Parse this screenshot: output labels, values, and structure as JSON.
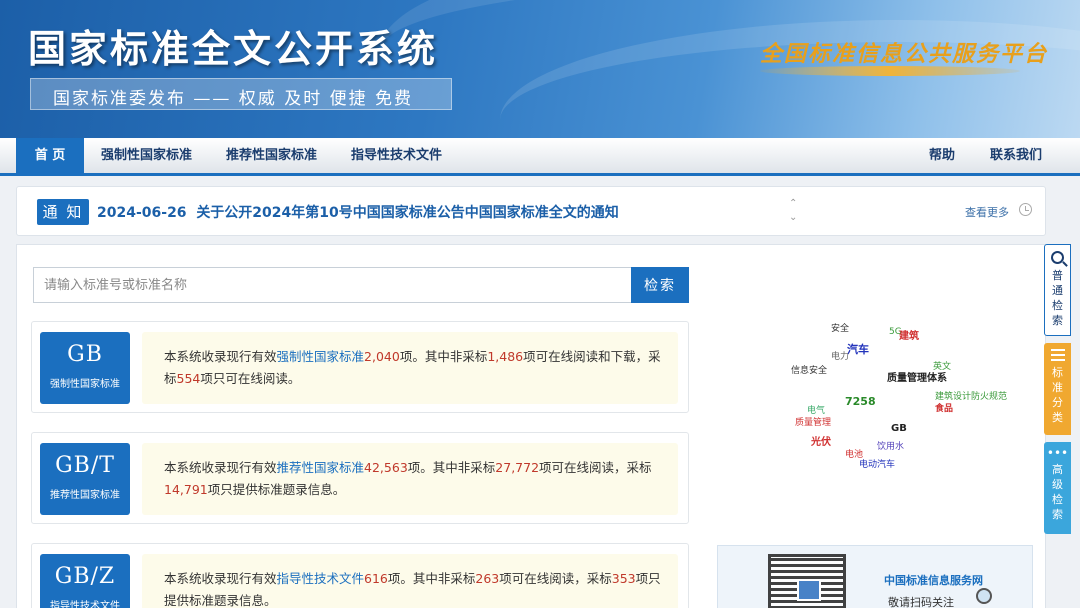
{
  "header": {
    "site_title": "国家标准全文公开系统",
    "slogan": "国家标准委发布 —— 权威 及时 便捷 免费",
    "platform": "全国标准信息公共服务平台"
  },
  "nav": {
    "items": [
      "首 页",
      "强制性国家标准",
      "推荐性国家标准",
      "指导性技术文件"
    ],
    "help": "帮助",
    "contact": "联系我们"
  },
  "notice": {
    "badge": "通 知",
    "date": "2024-06-26",
    "title": "关于公开2024年第10号中国国家标准公告中国国家标准全文的通知",
    "more": "查看更多"
  },
  "search": {
    "placeholder": "请输入标准号或标准名称",
    "button": "检索"
  },
  "cards": [
    {
      "code": "GB",
      "type": "强制性国家标准",
      "p1": "本系统收录现行有效",
      "link": "强制性国家标准",
      "count": "2,040",
      "p2": "项。其中非采标",
      "n1": "1,486",
      "p3": "项可在线阅读和下载，采标",
      "n2": "554",
      "p4": "项只可在线阅读。"
    },
    {
      "code": "GB/T",
      "type": "推荐性国家标准",
      "p1": "本系统收录现行有效",
      "link": "推荐性国家标准",
      "count": "42,563",
      "p2": "项。其中非采标",
      "n1": "27,772",
      "p3": "项可在线阅读，采标",
      "n2": "14,791",
      "p4": "项只提供标准题录信息。"
    },
    {
      "code": "GB/Z",
      "type": "指导性技术文件",
      "p1": "本系统收录现行有效",
      "link": "指导性技术文件",
      "count": "616",
      "p2": "项。其中非采标",
      "n1": "263",
      "p3": "项可在线阅读，采标",
      "n2": "353",
      "p4": "项只提供标准题录信息。"
    }
  ],
  "word_cloud": [
    {
      "text": "安全",
      "color": "#333333"
    },
    {
      "text": "5G",
      "color": "#3a9a3a"
    },
    {
      "text": "建筑",
      "color": "#d03030"
    },
    {
      "text": "汽车",
      "color": "#2233bb"
    },
    {
      "text": "电力",
      "color": "#666666"
    },
    {
      "text": "信息安全",
      "color": "#333333"
    },
    {
      "text": "英文",
      "color": "#3a9a3a"
    },
    {
      "text": "质量管理体系",
      "color": "#222222"
    },
    {
      "text": "建筑设计防火规范",
      "color": "#3a9a3a"
    },
    {
      "text": "7258",
      "color": "#2a8a2a"
    },
    {
      "text": "食品",
      "color": "#d03030"
    },
    {
      "text": "电气",
      "color": "#3aaa6a"
    },
    {
      "text": "质量管理",
      "color": "#d03030"
    },
    {
      "text": "GB",
      "color": "#222222"
    },
    {
      "text": "光伏",
      "color": "#d03030"
    },
    {
      "text": "饮用水",
      "color": "#5544bb"
    },
    {
      "text": "电池",
      "color": "#d03030"
    },
    {
      "text": "电动汽车",
      "color": "#2233bb"
    }
  ],
  "qr": {
    "title": "中国标准信息服务网",
    "hint": "敬请扫码关注"
  },
  "side_tabs": {
    "search": "普通检索",
    "classify": "标准分类",
    "advanced": "高级检索"
  },
  "icons": [
    "search-icon",
    "list-icon",
    "more-dots-icon",
    "clock-icon",
    "sort-arrows-icon",
    "magnifier-icon",
    "qr-code"
  ]
}
